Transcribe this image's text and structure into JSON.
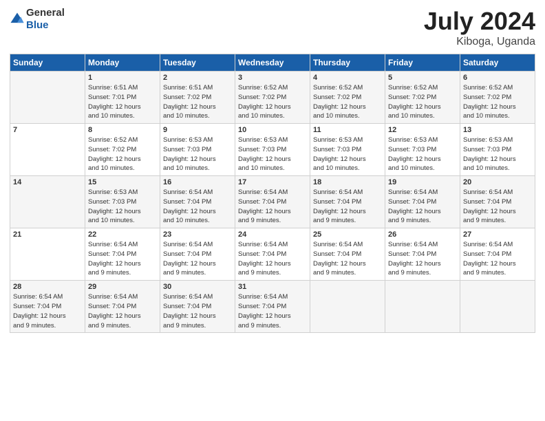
{
  "header": {
    "logo_general": "General",
    "logo_blue": "Blue",
    "title": "July 2024",
    "location": "Kiboga, Uganda"
  },
  "days_of_week": [
    "Sunday",
    "Monday",
    "Tuesday",
    "Wednesday",
    "Thursday",
    "Friday",
    "Saturday"
  ],
  "weeks": [
    [
      {
        "day": "",
        "info": ""
      },
      {
        "day": "1",
        "info": "Sunrise: 6:51 AM\nSunset: 7:01 PM\nDaylight: 12 hours\nand 10 minutes."
      },
      {
        "day": "2",
        "info": "Sunrise: 6:51 AM\nSunset: 7:02 PM\nDaylight: 12 hours\nand 10 minutes."
      },
      {
        "day": "3",
        "info": "Sunrise: 6:52 AM\nSunset: 7:02 PM\nDaylight: 12 hours\nand 10 minutes."
      },
      {
        "day": "4",
        "info": "Sunrise: 6:52 AM\nSunset: 7:02 PM\nDaylight: 12 hours\nand 10 minutes."
      },
      {
        "day": "5",
        "info": "Sunrise: 6:52 AM\nSunset: 7:02 PM\nDaylight: 12 hours\nand 10 minutes."
      },
      {
        "day": "6",
        "info": "Sunrise: 6:52 AM\nSunset: 7:02 PM\nDaylight: 12 hours\nand 10 minutes."
      }
    ],
    [
      {
        "day": "7",
        "info": ""
      },
      {
        "day": "8",
        "info": "Sunrise: 6:52 AM\nSunset: 7:02 PM\nDaylight: 12 hours\nand 10 minutes."
      },
      {
        "day": "9",
        "info": "Sunrise: 6:53 AM\nSunset: 7:03 PM\nDaylight: 12 hours\nand 10 minutes."
      },
      {
        "day": "10",
        "info": "Sunrise: 6:53 AM\nSunset: 7:03 PM\nDaylight: 12 hours\nand 10 minutes."
      },
      {
        "day": "11",
        "info": "Sunrise: 6:53 AM\nSunset: 7:03 PM\nDaylight: 12 hours\nand 10 minutes."
      },
      {
        "day": "12",
        "info": "Sunrise: 6:53 AM\nSunset: 7:03 PM\nDaylight: 12 hours\nand 10 minutes."
      },
      {
        "day": "13",
        "info": "Sunrise: 6:53 AM\nSunset: 7:03 PM\nDaylight: 12 hours\nand 10 minutes."
      }
    ],
    [
      {
        "day": "14",
        "info": ""
      },
      {
        "day": "15",
        "info": "Sunrise: 6:53 AM\nSunset: 7:03 PM\nDaylight: 12 hours\nand 10 minutes."
      },
      {
        "day": "16",
        "info": "Sunrise: 6:54 AM\nSunset: 7:04 PM\nDaylight: 12 hours\nand 10 minutes."
      },
      {
        "day": "17",
        "info": "Sunrise: 6:54 AM\nSunset: 7:04 PM\nDaylight: 12 hours\nand 9 minutes."
      },
      {
        "day": "18",
        "info": "Sunrise: 6:54 AM\nSunset: 7:04 PM\nDaylight: 12 hours\nand 9 minutes."
      },
      {
        "day": "19",
        "info": "Sunrise: 6:54 AM\nSunset: 7:04 PM\nDaylight: 12 hours\nand 9 minutes."
      },
      {
        "day": "20",
        "info": "Sunrise: 6:54 AM\nSunset: 7:04 PM\nDaylight: 12 hours\nand 9 minutes."
      }
    ],
    [
      {
        "day": "21",
        "info": ""
      },
      {
        "day": "22",
        "info": "Sunrise: 6:54 AM\nSunset: 7:04 PM\nDaylight: 12 hours\nand 9 minutes."
      },
      {
        "day": "23",
        "info": "Sunrise: 6:54 AM\nSunset: 7:04 PM\nDaylight: 12 hours\nand 9 minutes."
      },
      {
        "day": "24",
        "info": "Sunrise: 6:54 AM\nSunset: 7:04 PM\nDaylight: 12 hours\nand 9 minutes."
      },
      {
        "day": "25",
        "info": "Sunrise: 6:54 AM\nSunset: 7:04 PM\nDaylight: 12 hours\nand 9 minutes."
      },
      {
        "day": "26",
        "info": "Sunrise: 6:54 AM\nSunset: 7:04 PM\nDaylight: 12 hours\nand 9 minutes."
      },
      {
        "day": "27",
        "info": "Sunrise: 6:54 AM\nSunset: 7:04 PM\nDaylight: 12 hours\nand 9 minutes."
      }
    ],
    [
      {
        "day": "28",
        "info": "Sunrise: 6:54 AM\nSunset: 7:04 PM\nDaylight: 12 hours\nand 9 minutes."
      },
      {
        "day": "29",
        "info": "Sunrise: 6:54 AM\nSunset: 7:04 PM\nDaylight: 12 hours\nand 9 minutes."
      },
      {
        "day": "30",
        "info": "Sunrise: 6:54 AM\nSunset: 7:04 PM\nDaylight: 12 hours\nand 9 minutes."
      },
      {
        "day": "31",
        "info": "Sunrise: 6:54 AM\nSunset: 7:04 PM\nDaylight: 12 hours\nand 9 minutes."
      },
      {
        "day": "",
        "info": ""
      },
      {
        "day": "",
        "info": ""
      },
      {
        "day": "",
        "info": ""
      }
    ]
  ]
}
